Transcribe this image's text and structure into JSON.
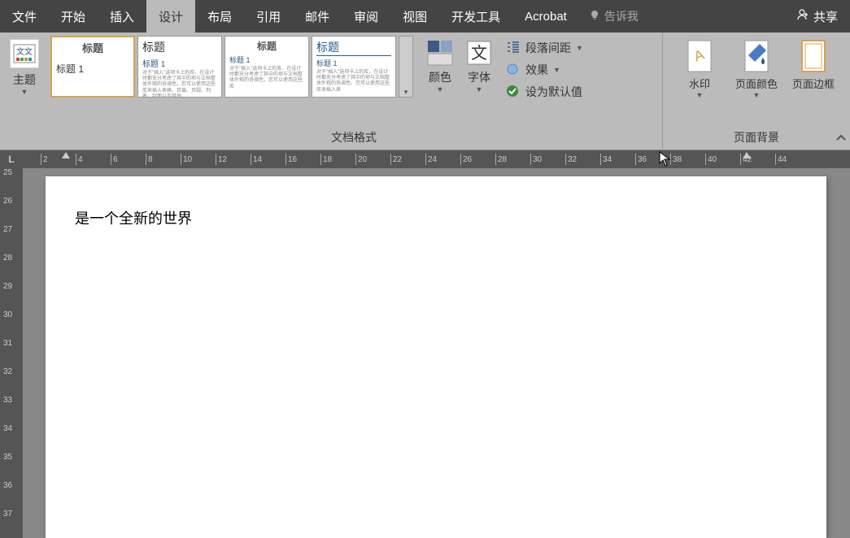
{
  "menu": {
    "items": [
      "文件",
      "开始",
      "插入",
      "设计",
      "布局",
      "引用",
      "邮件",
      "审阅",
      "视图",
      "开发工具",
      "Acrobat"
    ],
    "active_index": 3,
    "tell_me": "告诉我",
    "share": "共享"
  },
  "ribbon": {
    "themes_label": "主题",
    "doc_format_label": "文档格式",
    "colors_label": "颜色",
    "fonts_label": "字体",
    "paragraph_spacing": "段落间距",
    "effects": "效果",
    "set_default": "设为默认值",
    "page_bg_label": "页面背景",
    "watermark": "水印",
    "page_color": "页面颜色",
    "page_border": "页面边框",
    "style_gallery": [
      {
        "title": "标题",
        "heading": "标题 1",
        "body": ""
      },
      {
        "title": "标题",
        "heading": "标题 1",
        "body": "对于\"插入\"选项卡上的库，在设计时都充分考虑了其中的项与文档整体外观的协调性。您可以使用这些库来插入表格、页眉、页脚、列表、封面以及其他"
      },
      {
        "title": "标题",
        "heading": "标题 1",
        "body": "对于\"插入\"选项卡上的库，在设计时都充分考虑了其中的项与文档整体外观的协调性。您可以使用这些库"
      },
      {
        "title": "标题",
        "heading": "标题 1",
        "body": "对于\"插入\"选项卡上的库，在设计时都充分考虑了其中的项与文档整体外观的协调性。您可以使用这些库来插入表"
      }
    ]
  },
  "ruler": {
    "h_values": [
      "2",
      "4",
      "6",
      "8",
      "10",
      "12",
      "14",
      "16",
      "18",
      "20",
      "22",
      "24",
      "26",
      "28",
      "30",
      "32",
      "34",
      "36",
      "38",
      "40",
      "42",
      "44"
    ],
    "v_values": [
      "25",
      "26",
      "27",
      "28",
      "29",
      "30",
      "31",
      "32",
      "33",
      "34",
      "35",
      "36",
      "37"
    ]
  },
  "document": {
    "text": "是一个全新的世界"
  }
}
